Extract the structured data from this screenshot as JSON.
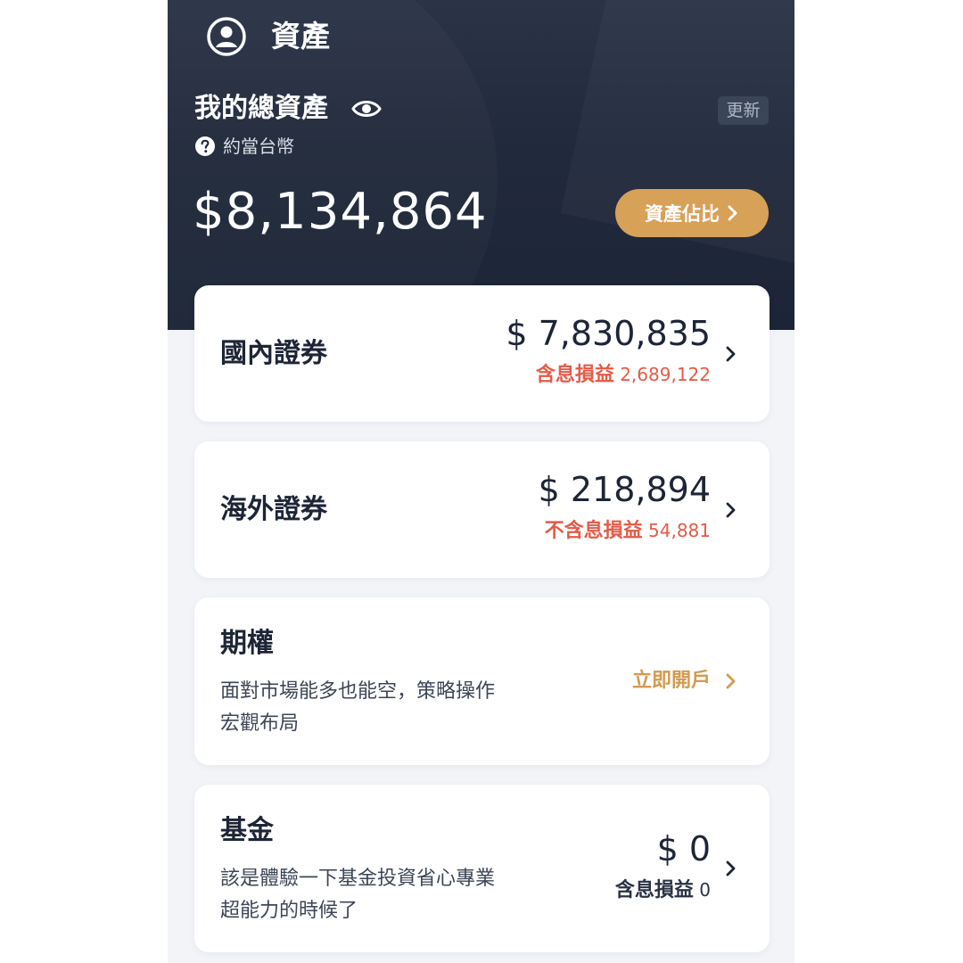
{
  "header": {
    "title": "資產",
    "total_label": "我的總資產",
    "update_label": "更新",
    "currency_note": "約當台幣",
    "total_amount": "$8,134,864",
    "allocation_button": "資產佔比"
  },
  "cards": [
    {
      "title": "國內證券",
      "amount": "$ 7,830,835",
      "pnl_label": "含息損益",
      "pnl_value": "2,689,122"
    },
    {
      "title": "海外證券",
      "amount": "$ 218,894",
      "pnl_label": "不含息損益",
      "pnl_value": "54,881"
    },
    {
      "title": "期權",
      "desc_line1": "面對市場能多也能空，策略操作",
      "desc_line2": "宏觀布局",
      "action_label": "立即開戶"
    },
    {
      "title": "基金",
      "desc_line1": "該是體驗一下基金投資省心專業",
      "desc_line2": "超能力的時候了",
      "amount": "$ 0",
      "pnl_label": "含息損益",
      "pnl_value": "0"
    }
  ],
  "colors": {
    "header_bg": "#212a3c",
    "accent_gold": "#d8a158",
    "loss_red": "#e45b47",
    "text_dark": "#1d2536"
  },
  "icons": [
    "user-circle-icon",
    "eye-icon",
    "question-icon",
    "chevron-right-icon"
  ]
}
